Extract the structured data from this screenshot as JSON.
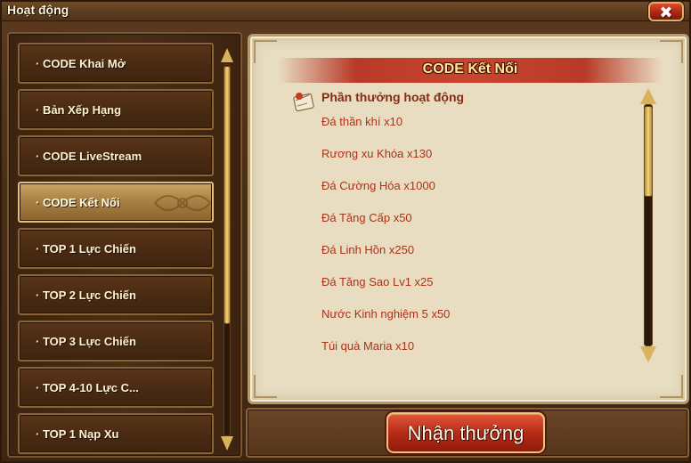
{
  "window": {
    "title": "Hoạt động",
    "close_symbol": "✖"
  },
  "menu": {
    "items": [
      {
        "label": "· CODE Khai Mở",
        "active": false
      },
      {
        "label": "· Bản Xếp Hạng",
        "active": false
      },
      {
        "label": "· CODE LiveStream",
        "active": false
      },
      {
        "label": "· CODE Kết Nối",
        "active": true
      },
      {
        "label": "· TOP 1 Lực Chiến",
        "active": false
      },
      {
        "label": "· TOP 2 Lực Chiến",
        "active": false
      },
      {
        "label": "· TOP 3 Lực Chiến",
        "active": false
      },
      {
        "label": "· TOP 4-10 Lực C...",
        "active": false
      },
      {
        "label": "· TOP 1 Nạp Xu",
        "active": false
      }
    ]
  },
  "detail": {
    "header": "CODE Kết Nối",
    "reward_title": "Phần thưởng hoạt động",
    "rewards": [
      "Đá thần khí x10",
      "Rương xu Khóa x130",
      "Đá Cường Hóa x1000",
      "Đá Tăng Cấp x50",
      "Đá Linh Hồn x250",
      "Đá Tăng Sao Lv1 x25",
      "Nước Kinh nghiệm 5 x50",
      "Túi quà Maria x10"
    ]
  },
  "actions": {
    "claim_label": "Nhận thưởng"
  },
  "colors": {
    "accent_gold": "#d9b35b",
    "reward_text": "#a8341a",
    "header_banner": "#c9452f",
    "button_red": "#b72c16"
  },
  "icons": {
    "close": "close-icon",
    "reward": "scroll-letter-icon",
    "scroll_up": "arrow-up-icon",
    "scroll_down": "arrow-down-icon"
  }
}
